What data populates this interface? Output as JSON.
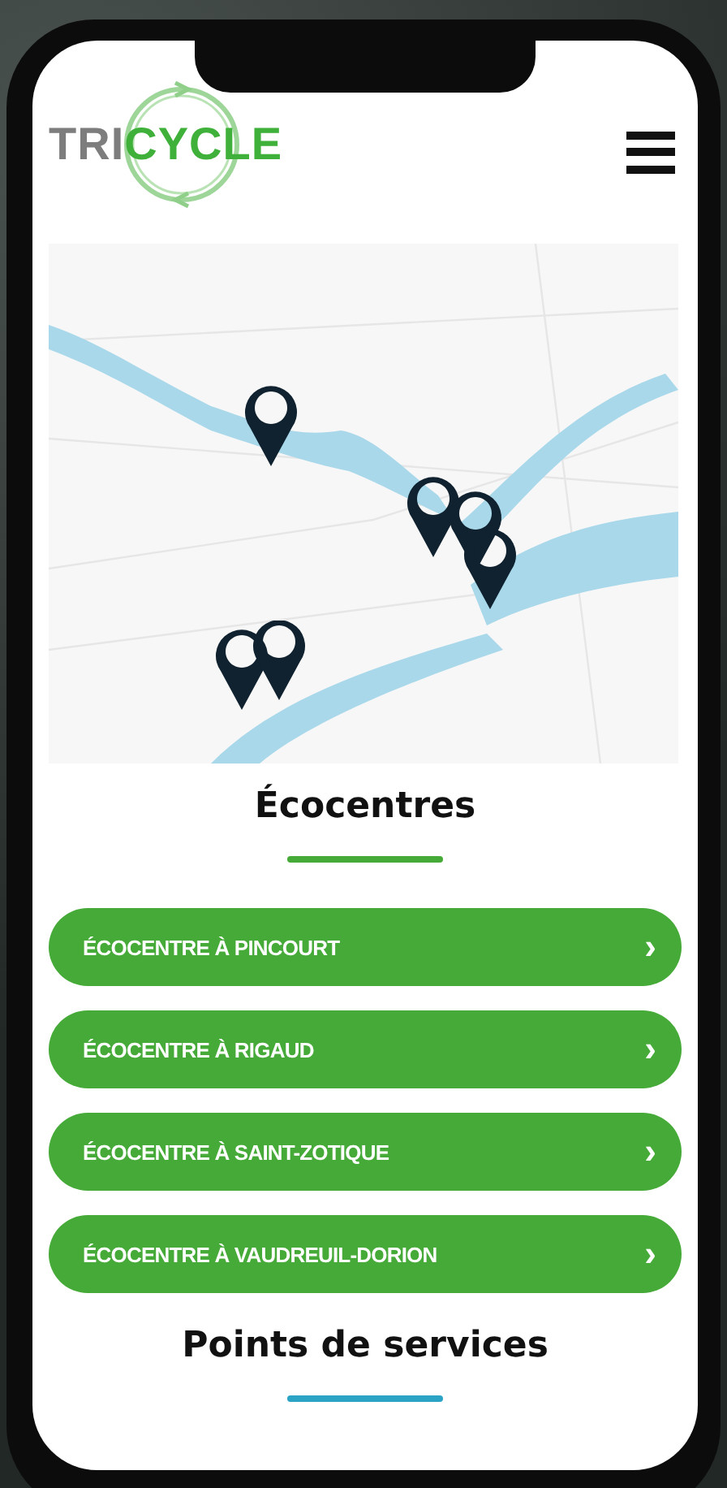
{
  "logo": {
    "prefix": "TRI",
    "suffix": "CYCLE"
  },
  "sections": [
    {
      "title": "Écocentres",
      "items": [
        {
          "label": "ÉCOCENTRE À PINCOURT",
          "arrow": "›"
        },
        {
          "label": "ÉCOCENTRE À RIGAUD",
          "arrow": "›"
        },
        {
          "label": "ÉCOCENTRE À SAINT-ZOTIQUE",
          "arrow": "›"
        },
        {
          "label": "ÉCOCENTRE À VAUDREUIL-DORION",
          "arrow": "›"
        }
      ]
    },
    {
      "title": "Points de services"
    }
  ]
}
